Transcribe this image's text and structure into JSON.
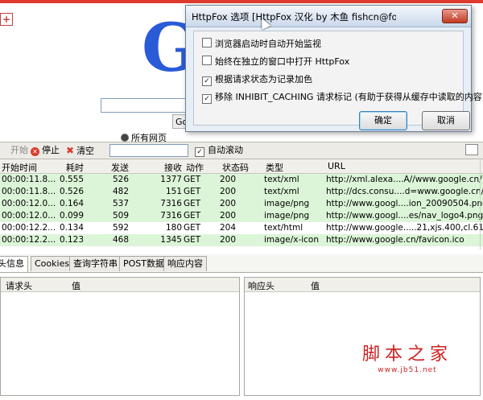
{
  "browser": {
    "logo": "G",
    "search_button": "Go",
    "radio_label": "所有网页"
  },
  "toolbar": {
    "start": "开始",
    "stop": "停止",
    "clear": "清空",
    "filter_value": "",
    "autoscroll": "自动滚动",
    "autoscroll_checked": true
  },
  "table": {
    "columns": [
      "开始时间",
      "耗时",
      "发送",
      "接收",
      "动作",
      "状态码",
      "类型",
      "URL"
    ],
    "rows": [
      {
        "time": "00:00:11.8...",
        "duration": "0.555",
        "sent": "526",
        "received": "1377",
        "method": "GET",
        "status": "200",
        "type": "text/xml",
        "url": "http://xml.alexa....A//www.google.cn/",
        "highlight": "green"
      },
      {
        "time": "00:00:11.8...",
        "duration": "0.526",
        "sent": "482",
        "received": "151",
        "method": "GET",
        "status": "200",
        "type": "text/xml",
        "url": "http://dcs.consu....d=www.google.cn/",
        "highlight": "green"
      },
      {
        "time": "00:00:12.0...",
        "duration": "0.164",
        "sent": "537",
        "received": "7316",
        "method": "GET",
        "status": "200",
        "type": "image/png",
        "url": "http://www.googl....ion_20090504.png",
        "highlight": "green"
      },
      {
        "time": "00:00:12.0...",
        "duration": "0.099",
        "sent": "509",
        "received": "7316",
        "method": "GET",
        "status": "200",
        "type": "image/png",
        "url": "http://www.googl....es/nav_logo4.png",
        "highlight": "green"
      },
      {
        "time": "00:00:12.2...",
        "duration": "0.134",
        "sent": "592",
        "received": "180",
        "method": "GET",
        "status": "204",
        "type": "text/html",
        "url": "http://www.google.....21,xjs.400,cl.618",
        "highlight": "white"
      },
      {
        "time": "00:00:12.2...",
        "duration": "0.123",
        "sent": "468",
        "received": "1345",
        "method": "GET",
        "status": "200",
        "type": "image/x-icon",
        "url": "http://www.google.cn/favicon.ico",
        "highlight": "green"
      }
    ]
  },
  "tabs": [
    "头信息",
    "Cookies",
    "查询字符串",
    "POST数据",
    "响应内容"
  ],
  "request_headers": {
    "col1": "请求头",
    "col2": "值"
  },
  "response_headers": {
    "col1": "响应头",
    "col2": "值"
  },
  "dialog": {
    "title": "HttpFox 选项 [HttpFox 汉化 by 木鱼 fishcn@foxmail.c...",
    "close": "✕",
    "options": [
      {
        "label": "浏览器启动时自动开始监视",
        "checked": false
      },
      {
        "label": "始终在独立的窗口中打开 HttpFox",
        "checked": false
      },
      {
        "label": "根据请求状态为记录加色",
        "checked": true
      },
      {
        "label": "移除 INHIBIT_CACHING 请求标记 (有助于获得从缓存中读取的内容)",
        "checked": true
      }
    ],
    "ok": "确定",
    "cancel": "取消"
  },
  "watermark": {
    "main": "脚本之家",
    "sub": "www.jb51.net"
  },
  "colors": {
    "row_green": "#dcf5d8",
    "accent_red": "#d83c2c",
    "google_blue": "#2a5bd7"
  }
}
